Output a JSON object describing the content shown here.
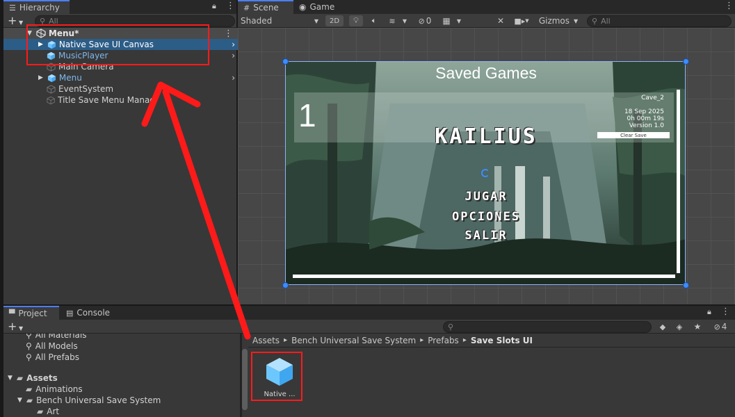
{
  "hierarchy": {
    "tab_label": "Hierarchy",
    "add_label": "+",
    "search_placeholder": "All",
    "items": [
      {
        "label": "Menu*",
        "kind": "scene"
      },
      {
        "label": "Native Save UI Canvas",
        "kind": "prefab"
      },
      {
        "label": "MusicPlayer",
        "kind": "prefab"
      },
      {
        "label": "Main Camera",
        "kind": "object"
      },
      {
        "label": "Menu",
        "kind": "prefab"
      },
      {
        "label": "EventSystem",
        "kind": "object"
      },
      {
        "label": "Title Save Menu Manag",
        "kind": "object"
      }
    ]
  },
  "scene_view": {
    "tabs": [
      {
        "label": "Scene"
      },
      {
        "label": "Game"
      }
    ],
    "shading_mode": "Shaded",
    "mode_2d": "2D",
    "hidden_count": "0",
    "gizmos_label": "Gizmos",
    "search_placeholder": "All"
  },
  "game_ui": {
    "title": "Saved Games",
    "slot": {
      "number": "1",
      "scene_name": "Cave_2",
      "date": "18 Sep 2025",
      "playtime": "0h 00m 19s",
      "version": "Version 1.0",
      "clear_label": "Clear Save"
    },
    "logo_text": "KAILIUS",
    "menu": [
      "JUGAR",
      "OPCIONES",
      "SALIR"
    ]
  },
  "project": {
    "tabs": [
      {
        "label": "Project"
      },
      {
        "label": "Console"
      }
    ],
    "add_label": "+",
    "hidden_count": "4",
    "favorites": [
      "All Materials",
      "All Models",
      "All Prefabs"
    ],
    "tree": [
      {
        "label": "Assets",
        "level": 0
      },
      {
        "label": "Animations",
        "level": 1
      },
      {
        "label": "Bench Universal Save System",
        "level": 1
      },
      {
        "label": "Art",
        "level": 2
      }
    ],
    "breadcrumb": [
      "Assets",
      "Bench Universal Save System",
      "Prefabs",
      "Save Slots UI"
    ],
    "assets": [
      {
        "label": "Native ..."
      }
    ]
  },
  "colors": {
    "selection": "#2c5d87",
    "prefab_text": "#7cb8ee",
    "annotation": "#ff1a1a",
    "accent_tab": "#4c7fff"
  }
}
